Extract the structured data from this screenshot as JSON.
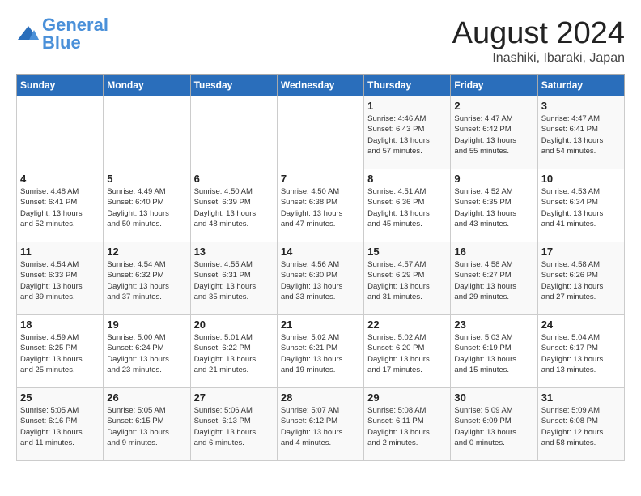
{
  "header": {
    "logo_general": "General",
    "logo_blue": "Blue",
    "title": "August 2024",
    "location": "Inashiki, Ibaraki, Japan"
  },
  "days_of_week": [
    "Sunday",
    "Monday",
    "Tuesday",
    "Wednesday",
    "Thursday",
    "Friday",
    "Saturday"
  ],
  "weeks": [
    [
      {
        "day": "",
        "info": ""
      },
      {
        "day": "",
        "info": ""
      },
      {
        "day": "",
        "info": ""
      },
      {
        "day": "",
        "info": ""
      },
      {
        "day": "1",
        "info": "Sunrise: 4:46 AM\nSunset: 6:43 PM\nDaylight: 13 hours\nand 57 minutes."
      },
      {
        "day": "2",
        "info": "Sunrise: 4:47 AM\nSunset: 6:42 PM\nDaylight: 13 hours\nand 55 minutes."
      },
      {
        "day": "3",
        "info": "Sunrise: 4:47 AM\nSunset: 6:41 PM\nDaylight: 13 hours\nand 54 minutes."
      }
    ],
    [
      {
        "day": "4",
        "info": "Sunrise: 4:48 AM\nSunset: 6:41 PM\nDaylight: 13 hours\nand 52 minutes."
      },
      {
        "day": "5",
        "info": "Sunrise: 4:49 AM\nSunset: 6:40 PM\nDaylight: 13 hours\nand 50 minutes."
      },
      {
        "day": "6",
        "info": "Sunrise: 4:50 AM\nSunset: 6:39 PM\nDaylight: 13 hours\nand 48 minutes."
      },
      {
        "day": "7",
        "info": "Sunrise: 4:50 AM\nSunset: 6:38 PM\nDaylight: 13 hours\nand 47 minutes."
      },
      {
        "day": "8",
        "info": "Sunrise: 4:51 AM\nSunset: 6:36 PM\nDaylight: 13 hours\nand 45 minutes."
      },
      {
        "day": "9",
        "info": "Sunrise: 4:52 AM\nSunset: 6:35 PM\nDaylight: 13 hours\nand 43 minutes."
      },
      {
        "day": "10",
        "info": "Sunrise: 4:53 AM\nSunset: 6:34 PM\nDaylight: 13 hours\nand 41 minutes."
      }
    ],
    [
      {
        "day": "11",
        "info": "Sunrise: 4:54 AM\nSunset: 6:33 PM\nDaylight: 13 hours\nand 39 minutes."
      },
      {
        "day": "12",
        "info": "Sunrise: 4:54 AM\nSunset: 6:32 PM\nDaylight: 13 hours\nand 37 minutes."
      },
      {
        "day": "13",
        "info": "Sunrise: 4:55 AM\nSunset: 6:31 PM\nDaylight: 13 hours\nand 35 minutes."
      },
      {
        "day": "14",
        "info": "Sunrise: 4:56 AM\nSunset: 6:30 PM\nDaylight: 13 hours\nand 33 minutes."
      },
      {
        "day": "15",
        "info": "Sunrise: 4:57 AM\nSunset: 6:29 PM\nDaylight: 13 hours\nand 31 minutes."
      },
      {
        "day": "16",
        "info": "Sunrise: 4:58 AM\nSunset: 6:27 PM\nDaylight: 13 hours\nand 29 minutes."
      },
      {
        "day": "17",
        "info": "Sunrise: 4:58 AM\nSunset: 6:26 PM\nDaylight: 13 hours\nand 27 minutes."
      }
    ],
    [
      {
        "day": "18",
        "info": "Sunrise: 4:59 AM\nSunset: 6:25 PM\nDaylight: 13 hours\nand 25 minutes."
      },
      {
        "day": "19",
        "info": "Sunrise: 5:00 AM\nSunset: 6:24 PM\nDaylight: 13 hours\nand 23 minutes."
      },
      {
        "day": "20",
        "info": "Sunrise: 5:01 AM\nSunset: 6:22 PM\nDaylight: 13 hours\nand 21 minutes."
      },
      {
        "day": "21",
        "info": "Sunrise: 5:02 AM\nSunset: 6:21 PM\nDaylight: 13 hours\nand 19 minutes."
      },
      {
        "day": "22",
        "info": "Sunrise: 5:02 AM\nSunset: 6:20 PM\nDaylight: 13 hours\nand 17 minutes."
      },
      {
        "day": "23",
        "info": "Sunrise: 5:03 AM\nSunset: 6:19 PM\nDaylight: 13 hours\nand 15 minutes."
      },
      {
        "day": "24",
        "info": "Sunrise: 5:04 AM\nSunset: 6:17 PM\nDaylight: 13 hours\nand 13 minutes."
      }
    ],
    [
      {
        "day": "25",
        "info": "Sunrise: 5:05 AM\nSunset: 6:16 PM\nDaylight: 13 hours\nand 11 minutes."
      },
      {
        "day": "26",
        "info": "Sunrise: 5:05 AM\nSunset: 6:15 PM\nDaylight: 13 hours\nand 9 minutes."
      },
      {
        "day": "27",
        "info": "Sunrise: 5:06 AM\nSunset: 6:13 PM\nDaylight: 13 hours\nand 6 minutes."
      },
      {
        "day": "28",
        "info": "Sunrise: 5:07 AM\nSunset: 6:12 PM\nDaylight: 13 hours\nand 4 minutes."
      },
      {
        "day": "29",
        "info": "Sunrise: 5:08 AM\nSunset: 6:11 PM\nDaylight: 13 hours\nand 2 minutes."
      },
      {
        "day": "30",
        "info": "Sunrise: 5:09 AM\nSunset: 6:09 PM\nDaylight: 13 hours\nand 0 minutes."
      },
      {
        "day": "31",
        "info": "Sunrise: 5:09 AM\nSunset: 6:08 PM\nDaylight: 12 hours\nand 58 minutes."
      }
    ]
  ]
}
